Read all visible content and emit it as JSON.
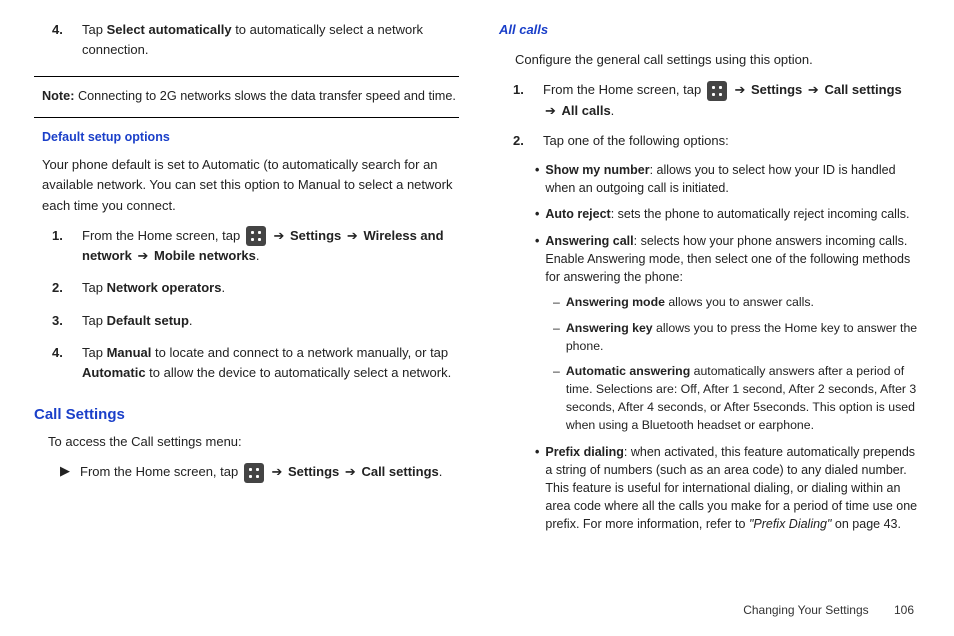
{
  "left": {
    "step4_pre": "Tap ",
    "step4_b1": "Select automatically",
    "step4_post": " to automatically select a network connection.",
    "note_label": "Note:",
    "note_text": " Connecting to 2G networks slows the data transfer speed and time.",
    "default_heading": "Default setup options",
    "default_para": "Your phone default is set to Automatic (to automatically search for an available network. You can set this option to Manual to select a network each time you connect.",
    "d1_pre": "From the Home screen, tap ",
    "arrow": "➔",
    "d1_settings": "Settings",
    "d1_wireless": "Wireless and network",
    "d1_mobile": "Mobile networks",
    "d2_pre": "Tap ",
    "d2_b": "Network operators",
    "d3_pre": "Tap ",
    "d3_b": "Default setup",
    "d4_pre": "Tap ",
    "d4_b1": "Manual",
    "d4_mid": " to locate and connect to a network manually, or tap ",
    "d4_b2": "Automatic",
    "d4_post": " to allow the device to automatically select a network.",
    "call_heading": "Call Settings",
    "call_intro": "To access the Call settings menu:",
    "call_a_pre": "From the Home screen, tap ",
    "call_a_settings": "Settings",
    "call_a_call": "Call settings"
  },
  "right": {
    "allcalls_heading": "All calls",
    "allcalls_intro": "Configure the general call settings using this option.",
    "a1_pre": "From the Home screen, tap ",
    "a1_settings": "Settings",
    "a1_call": "Call settings",
    "a1_all": "All calls",
    "a2": "Tap one of the following options:",
    "b_show_t": "Show my number",
    "b_show_d": ": allows you to select how your ID is handled when an outgoing call is initiated.",
    "b_auto_t": "Auto reject",
    "b_auto_d": ": sets the phone to automatically reject incoming calls.",
    "b_ans_t": "Answering call",
    "b_ans_d": ": selects how your phone answers incoming calls. Enable Answering mode, then select one of the following methods for answering the phone:",
    "d_mode_t": "Answering mode",
    "d_mode_d": " allows you to answer calls.",
    "d_key_t": "Answering key",
    "d_key_d": " allows you to press the Home key to answer the phone.",
    "d_auto_t": "Automatic answering",
    "d_auto_d": " automatically answers after a period of time. Selections are: Off, After 1 second, After 2 seconds, After 3 seconds, After 4 seconds, or After 5seconds. This option is used when using a Bluetooth headset or earphone.",
    "b_prefix_t": "Prefix dialing",
    "b_prefix_d": ": when activated, this feature automatically prepends a string of numbers (such as an area code) to any dialed number. This feature is useful for international dialing, or dialing within an area code where all the calls you make for a period of time use one prefix. For more information, refer to ",
    "b_prefix_xref": "\"Prefix Dialing\"",
    "b_prefix_tail": "  on page 43."
  },
  "footer": {
    "section": "Changing Your Settings",
    "page": "106"
  },
  "nums": {
    "n1": "1.",
    "n2": "2.",
    "n3": "3.",
    "n4": "4."
  },
  "glyphs": {
    "bullet": "•",
    "dash": "–",
    "play": "▶"
  }
}
